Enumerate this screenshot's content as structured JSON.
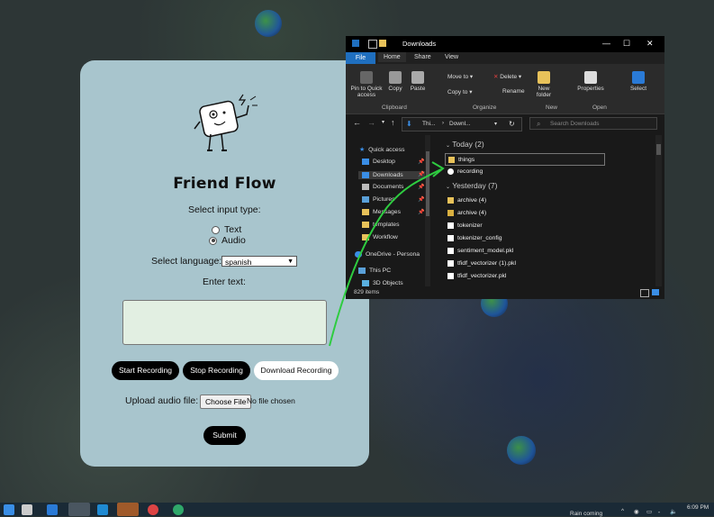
{
  "app": {
    "title": "Friend Flow",
    "input_type_label": "Select input type:",
    "options": [
      {
        "label": "Text",
        "selected": false
      },
      {
        "label": "Audio",
        "selected": true
      }
    ],
    "language_label": "Select language:",
    "language_value": "spanish",
    "enter_text_label": "Enter text:",
    "buttons": {
      "start": "Start Recording",
      "stop": "Stop Recording",
      "download": "Download Recording"
    },
    "upload_label": "Upload audio file:",
    "choose_file": "Choose File",
    "file_status": "No file chosen",
    "submit": "Submit"
  },
  "explorer": {
    "title": "Downloads",
    "tabs": [
      "File",
      "Home",
      "Share",
      "View"
    ],
    "ribbon": {
      "pin": "Pin to Quick access",
      "copy": "Copy",
      "paste": "Paste",
      "move_to": "Move to",
      "copy_to": "Copy to",
      "delete": "Delete",
      "rename": "Rename",
      "new_folder": "New folder",
      "properties": "Properties",
      "select": "Select",
      "groups": [
        "Clipboard",
        "Organize",
        "New",
        "Open"
      ]
    },
    "address": {
      "crumb1": "Thi...",
      "crumb2": "Downl..."
    },
    "search_placeholder": "Search Downloads",
    "nav": [
      {
        "label": "Quick access",
        "pinned": false
      },
      {
        "label": "Desktop",
        "pinned": true
      },
      {
        "label": "Downloads",
        "pinned": true
      },
      {
        "label": "Documents",
        "pinned": true
      },
      {
        "label": "Pictures",
        "pinned": true
      },
      {
        "label": "Messages",
        "pinned": true
      },
      {
        "label": "templates",
        "pinned": false
      },
      {
        "label": "Workflow",
        "pinned": false
      },
      {
        "label": "OneDrive - Persona",
        "pinned": false
      },
      {
        "label": "This PC",
        "pinned": false
      },
      {
        "label": "3D Objects",
        "pinned": false
      }
    ],
    "groups": [
      {
        "header": "Today (2)",
        "files": [
          {
            "name": "things",
            "type": "folder",
            "selected": true
          },
          {
            "name": "recording",
            "type": "audio",
            "selected": false
          }
        ]
      },
      {
        "header": "Yesterday (7)",
        "files": [
          {
            "name": "archive (4)",
            "type": "folder",
            "selected": false
          },
          {
            "name": "archive (4)",
            "type": "zip",
            "selected": false
          },
          {
            "name": "tokenizer",
            "type": "file",
            "selected": false
          },
          {
            "name": "tokenizer_config",
            "type": "file",
            "selected": false
          },
          {
            "name": "sentiment_model.pkl",
            "type": "file",
            "selected": false
          },
          {
            "name": "tfidf_vectorizer (1).pkl",
            "type": "file",
            "selected": false
          },
          {
            "name": "tfidf_vectorizer.pkl",
            "type": "file",
            "selected": false
          }
        ]
      }
    ],
    "status": "829 items"
  },
  "taskbar": {
    "weather": "Rain coming",
    "time": "6:09 PM"
  },
  "colors": {
    "card_bg": "#a8c5cd",
    "textarea_bg": "#e2efe2",
    "arrow": "#2ecc40",
    "explorer_bg": "#191919",
    "file_tab": "#1f6fbf"
  }
}
